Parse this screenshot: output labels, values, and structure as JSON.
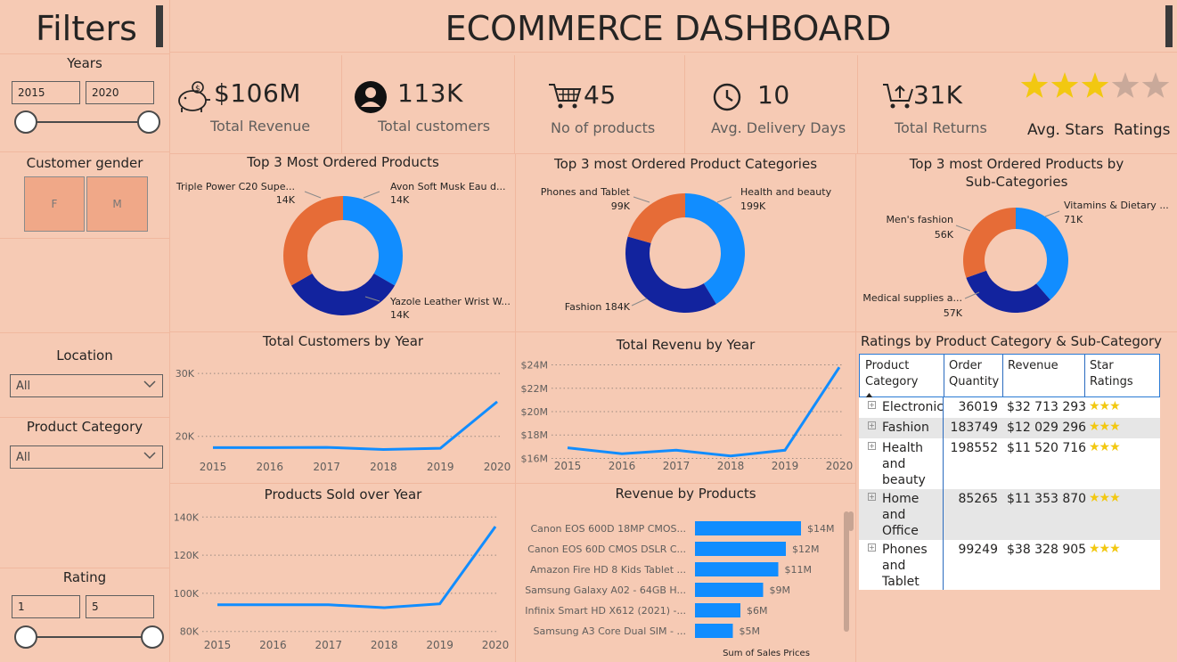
{
  "filters": {
    "title": "Filters",
    "years": {
      "label": "Years",
      "from": "2015",
      "to": "2020"
    },
    "gender": {
      "label": "Customer gender",
      "options": [
        "F",
        "M"
      ]
    },
    "location": {
      "label": "Location",
      "value": "All"
    },
    "category": {
      "label": "Product Category",
      "value": "All"
    },
    "rating": {
      "label": "Rating",
      "from": "1",
      "to": "5"
    }
  },
  "header": {
    "title": "ECOMMERCE DASHBOARD"
  },
  "kpis": [
    {
      "icon": "piggy-bank-icon",
      "value": "$106M",
      "label": "Total Revenue"
    },
    {
      "icon": "user-circle-icon",
      "value": "113K",
      "label": "Total customers"
    },
    {
      "icon": "cart-icon",
      "value": "45",
      "label": "No of products"
    },
    {
      "icon": "clock-icon",
      "value": "10",
      "label": "Avg. Delivery Days"
    },
    {
      "icon": "return-cart-icon",
      "value": "31K",
      "label": "Total Returns"
    },
    {
      "icon": "star-icon",
      "value": "",
      "label": "Avg. Stars  Ratings",
      "stars_filled": 3,
      "stars_total": 5
    }
  ],
  "donuts": [
    {
      "title": "Top 3 Most Ordered Products",
      "segments": [
        {
          "label": "Avon Soft Musk Eau d...",
          "value": "14K",
          "color": "#118dff"
        },
        {
          "label": "Yazole Leather Wrist W...",
          "value": "14K",
          "color": "#12239e"
        },
        {
          "label": "Triple Power C20 Supe...",
          "value": "14K",
          "color": "#e66c37"
        }
      ]
    },
    {
      "title": "Top 3 most Ordered Product Categories",
      "segments": [
        {
          "label": "Health and beauty",
          "value": "199K",
          "color": "#118dff"
        },
        {
          "label": "Fashion",
          "value": "184K",
          "color": "#12239e"
        },
        {
          "label": "Phones and Tablet",
          "value": "99K",
          "color": "#e66c37"
        }
      ]
    },
    {
      "title": "Top 3 most Ordered Products by Sub-Categories",
      "title_line1": "Top 3 most Ordered Products by",
      "title_line2": "Sub-Categories",
      "segments": [
        {
          "label": "Vitamins & Dietary ...",
          "value": "71K",
          "color": "#118dff"
        },
        {
          "label": "Medical supplies a...",
          "value": "57K",
          "color": "#12239e"
        },
        {
          "label": "Men's fashion",
          "value": "56K",
          "color": "#e66c37"
        }
      ]
    }
  ],
  "chart_data": [
    {
      "type": "line",
      "title": "Total Customers by Year",
      "x": [
        2015,
        2016,
        2017,
        2018,
        2019,
        2020
      ],
      "series": [
        {
          "values": [
            18200,
            18200,
            18250,
            17900,
            18100,
            25500
          ]
        }
      ],
      "yticks": [
        "20K",
        "30K"
      ],
      "ylim": [
        15000,
        32000
      ]
    },
    {
      "type": "line",
      "title": "Total Revenu by Year",
      "x": [
        2015,
        2016,
        2017,
        2018,
        2019,
        2020
      ],
      "series": [
        {
          "values": [
            16.9,
            16.4,
            16.7,
            16.2,
            16.7,
            23.8
          ]
        }
      ],
      "yticks": [
        "$16M",
        "$18M",
        "$20M",
        "$22M",
        "$24M"
      ],
      "ylim": [
        15.5,
        24.5
      ]
    },
    {
      "type": "line",
      "title": "Products Sold over Year",
      "x": [
        2015,
        2016,
        2017,
        2018,
        2019,
        2020
      ],
      "series": [
        {
          "values": [
            94000,
            94000,
            94000,
            92500,
            94500,
            135000
          ]
        }
      ],
      "yticks": [
        "80K",
        "100K",
        "120K",
        "140K"
      ],
      "ylim": [
        78000,
        142000
      ]
    },
    {
      "type": "bar",
      "title": "Revenue by Products",
      "categories": [
        "Canon EOS 600D 18MP CMOS...",
        "Canon EOS 60D CMOS DSLR C...",
        "Amazon Fire HD 8 Kids Tablet ...",
        "Samsung Galaxy A02 - 64GB H...",
        "Infinix Smart HD X612 (2021) -...",
        "Samsung A3 Core Dual SIM - ..."
      ],
      "values": [
        14,
        12,
        11,
        9,
        6,
        5
      ],
      "labels": [
        "$14M",
        "$12M",
        "$11M",
        "$9M",
        "$6M",
        "$5M"
      ],
      "xlabel": "Sum of Sales Prices"
    }
  ],
  "table": {
    "title": "Ratings by Product Category & Sub-Category",
    "headers": [
      "Product Category",
      "Order Quantity",
      "Revenue",
      "Star Ratings"
    ],
    "rows": [
      {
        "category": "Electronic",
        "qty": "36019",
        "revenue": "$32 713 293",
        "stars": "★★★"
      },
      {
        "category": "Fashion",
        "qty": "183749",
        "revenue": "$12 029 296",
        "stars": "★★★"
      },
      {
        "category": "Health and beauty",
        "qty": "198552",
        "revenue": "$11 520 716",
        "stars": "★★★"
      },
      {
        "category": "Home and Office",
        "qty": "85265",
        "revenue": "$11 353 870",
        "stars": "★★★"
      },
      {
        "category": "Phones and Tablet",
        "qty": "99249",
        "revenue": "$38 328 905",
        "stars": "★★★"
      }
    ]
  },
  "colors": {
    "background": "#f6cab4",
    "accent_blue": "#118dff",
    "dark_blue": "#12239e",
    "orange": "#e66c37",
    "star": "#f2c811"
  }
}
